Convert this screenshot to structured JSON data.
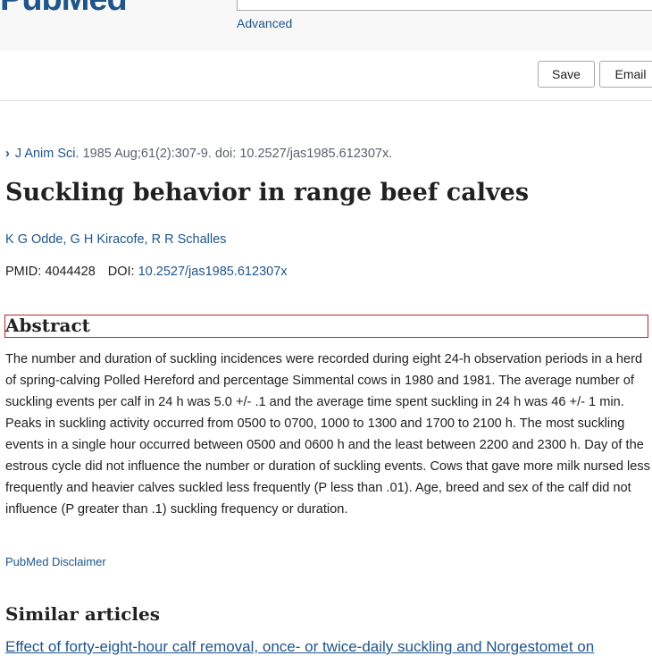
{
  "header": {
    "logo_text": "PubMed",
    "advanced_label": "Advanced"
  },
  "actions": {
    "save_label": "Save",
    "email_label": "Email"
  },
  "citation": {
    "journal": "J Anim Sci.",
    "details": " 1985 Aug;61(2):307-9. doi: 10.2527/jas1985.612307x."
  },
  "article": {
    "title": "Suckling behavior in range beef calves",
    "authors": [
      "K G Odde",
      "G H Kiracofe",
      "R R Schalles"
    ],
    "pmid_label": "PMID: ",
    "pmid": "4044428",
    "doi_label": "DOI: ",
    "doi": "10.2527/jas1985.612307x"
  },
  "abstract": {
    "heading": "Abstract",
    "text": "The number and duration of suckling incidences were recorded during eight 24-h observation periods in a herd of spring-calving Polled Hereford and percentage Simmental cows in 1980 and 1981. The average number of suckling events per calf in 24 h was 5.0 +/- .1 and the average time spent suckling in 24 h was 46 +/- 1 min. Peaks in suckling activity occurred from 0500 to 0700, 1000 to 1300 and 1700 to 2100 h. The most suckling events in a single hour occurred between 0500 and 0600 h and the least between 2200 and 2300 h. Day of the estrous cycle did not influence the number or duration of suckling events. Cows that gave more milk nursed less frequently and heavier calves suckled less frequently (P less than .01). Age, breed and sex of the calf did not influence (P greater than .1) suckling frequency or duration.",
    "disclaimer": "PubMed Disclaimer"
  },
  "similar": {
    "heading": "Similar articles",
    "first_link": "Effect of forty-eight-hour calf removal, once- or twice-daily suckling and Norgestomet on"
  },
  "colors": {
    "link": "#20558a",
    "highlight_border": "#c0222b"
  }
}
